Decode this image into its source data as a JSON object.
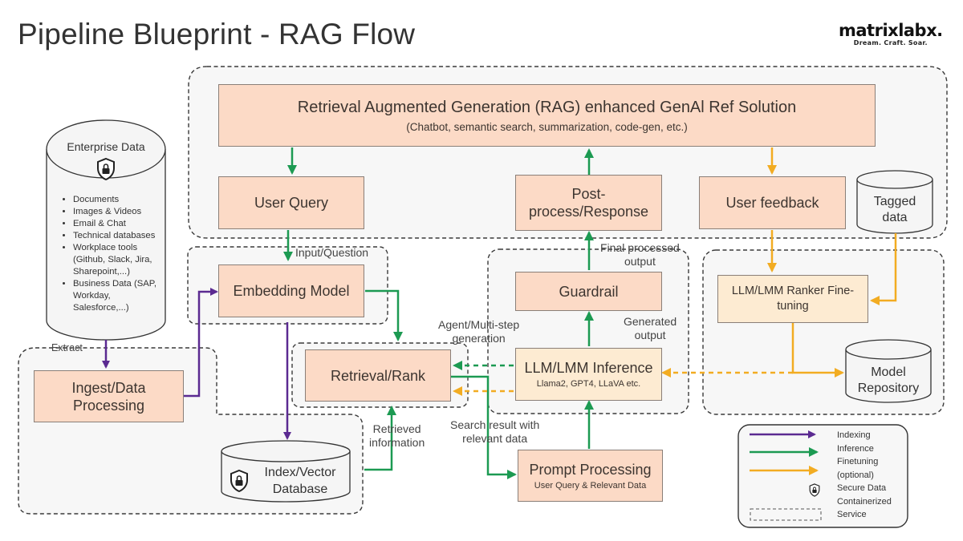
{
  "header": {
    "title": "Pipeline Blueprint - RAG Flow",
    "logo_name": "matrixlabx.",
    "logo_tagline": "Dream. Craft. Soar."
  },
  "nodes": {
    "rag_solution": {
      "title": "Retrieval Augmented Generation (RAG) enhanced GenAl Ref Solution",
      "subtitle": "(Chatbot, semantic search, summarization, code-gen, etc.)"
    },
    "user_query": {
      "label": "User Query"
    },
    "post_process": {
      "label_line1": "Post-",
      "label_line2": "process/Response"
    },
    "user_feedback": {
      "label": "User feedback"
    },
    "tagged_data": {
      "label_line1": "Tagged",
      "label_line2": "data"
    },
    "enterprise_data": {
      "title": "Enterprise Data",
      "items": [
        "Documents",
        "Images & Videos",
        "Email & Chat",
        "Technical databases",
        "Workplace tools (Github, Slack, Jira, Sharepoint,...)",
        "Business Data (SAP, Workday, Salesforce,...)"
      ]
    },
    "embedding_model": {
      "label": "Embedding Model"
    },
    "guardrail": {
      "label": "Guardrail"
    },
    "ranker_finetuning": {
      "label_line1": "LLM/LMM Ranker Fine-",
      "label_line2": "tuning"
    },
    "retrieval_rank": {
      "label": "Retrieval/Rank"
    },
    "llm_inference": {
      "label": "LLM/LMM Inference",
      "sublabel": "Llama2, GPT4, LLaVA etc."
    },
    "model_repository": {
      "label_line1": "Model",
      "label_line2": "Repository"
    },
    "ingest": {
      "label_line1": "Ingest/Data",
      "label_line2": "Processing"
    },
    "index_db": {
      "label_line1": "Index/Vector",
      "label_line2": "Database"
    },
    "prompt_processing": {
      "label": "Prompt Processing",
      "sublabel": "User Query & Relevant Data"
    }
  },
  "edge_labels": {
    "input_question": "Input/Question",
    "final_output_1": "Final processed",
    "final_output_2": "output",
    "agent_1": "Agent/Multi-step",
    "agent_2": "generation",
    "generated_1": "Generated",
    "generated_2": "output",
    "extract": "Extract",
    "retrieved_1": "Retrieved",
    "retrieved_2": "information",
    "search_1": "Search result with",
    "search_2": "relevant data"
  },
  "legend": {
    "items": [
      {
        "label": "Indexing",
        "color": "#5b2a91"
      },
      {
        "label": "Inference",
        "color": "#1c9a52"
      },
      {
        "label": "Finetuning",
        "color": "#f2ac22"
      },
      {
        "label": "(optional)"
      },
      {
        "label": "Secure Data"
      },
      {
        "label": "Containerized"
      },
      {
        "label": "Service"
      }
    ]
  },
  "colors": {
    "indexing": "#5b2a91",
    "inference": "#1c9a52",
    "finetuning": "#f2ac22",
    "box_fill": "#fcdac6",
    "box_fill_light": "#fdebd2"
  }
}
